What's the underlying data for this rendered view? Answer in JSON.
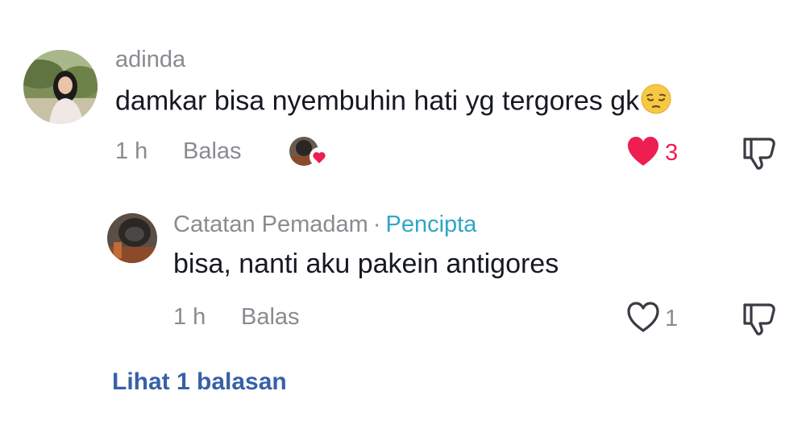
{
  "comments": [
    {
      "username": "adinda",
      "text": "damkar bisa nyembuhin hati yg tergores gk",
      "emoji": "pensive-face",
      "time": "1 h",
      "reply_label": "Balas",
      "liked": true,
      "like_count": "3"
    },
    {
      "username": "Catatan Pemadam",
      "separator": "·",
      "badge": "Pencipta",
      "text": "bisa, nanti aku pakein antigores",
      "time": "1 h",
      "reply_label": "Balas",
      "liked": false,
      "like_count": "1"
    }
  ],
  "view_replies": "Lihat 1 balasan",
  "colors": {
    "like_active": "#ee1d52",
    "creator_badge": "#2ea6c6",
    "view_replies": "#3860a8",
    "meta_text": "#8a8b91"
  },
  "icons": [
    "avatar",
    "heart-filled-icon",
    "heart-outline-icon",
    "dislike-icon",
    "creator-liked-icon",
    "pensive-emoji-icon"
  ]
}
